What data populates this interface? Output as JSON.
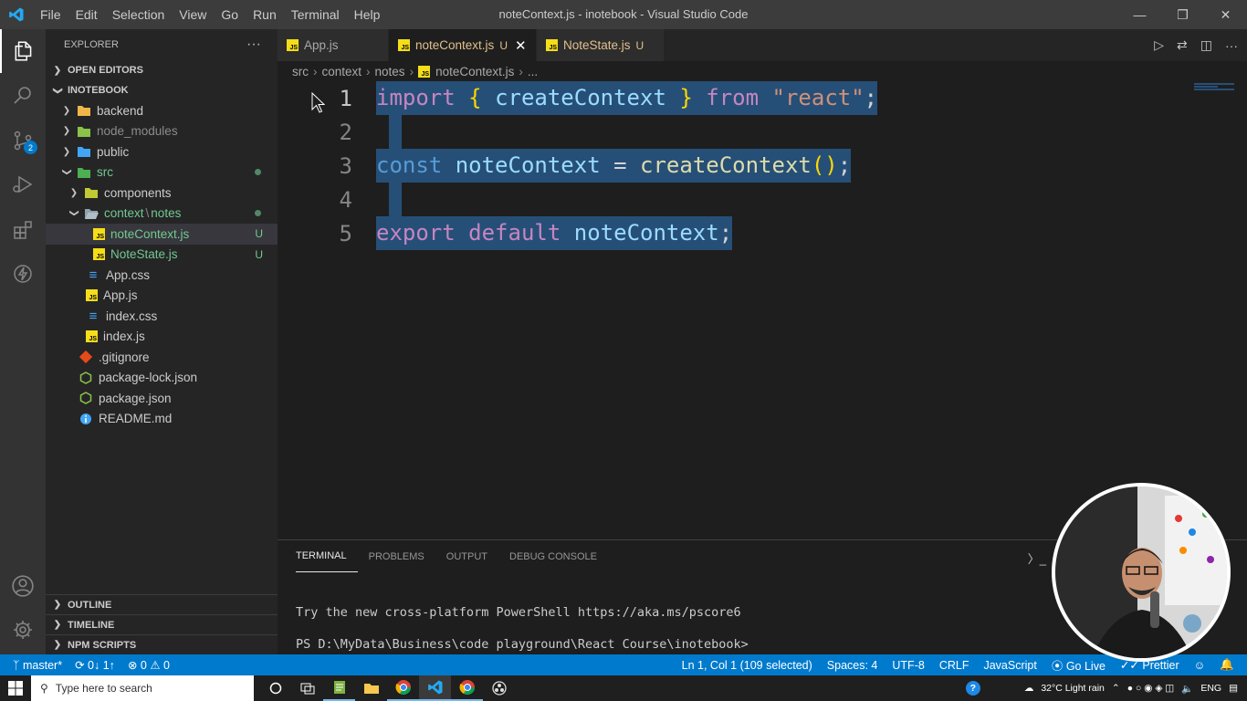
{
  "window": {
    "title": "noteContext.js - inotebook - Visual Studio Code",
    "menu": [
      "File",
      "Edit",
      "Selection",
      "View",
      "Go",
      "Run",
      "Terminal",
      "Help"
    ]
  },
  "activity": {
    "scm_badge": "2"
  },
  "sidebar": {
    "header": "EXPLORER",
    "more": "···",
    "open_editors": "OPEN EDITORS",
    "project": "INOTEBOOK",
    "tree": {
      "backend": "backend",
      "node_modules": "node_modules",
      "public": "public",
      "src": "src",
      "components": "components",
      "context": "context",
      "context_sep": "\\",
      "notes": "notes",
      "noteContext": "noteContext.js",
      "noteState": "NoteState.js",
      "app_css": "App.css",
      "app_js": "App.js",
      "index_css": "index.css",
      "index_js": "index.js",
      "gitignore": ".gitignore",
      "package_lock": "package-lock.json",
      "package": "package.json",
      "readme": "README.md"
    },
    "untracked": "U",
    "outline": "OUTLINE",
    "timeline": "TIMELINE",
    "npm": "NPM SCRIPTS"
  },
  "tabs": [
    {
      "label": "App.js"
    },
    {
      "label": "noteContext.js",
      "status": "U"
    },
    {
      "label": "NoteState.js",
      "status": "U"
    }
  ],
  "breadcrumb": [
    "src",
    "context",
    "notes",
    "noteContext.js",
    "..."
  ],
  "code": {
    "line_numbers": [
      "1",
      "2",
      "3",
      "4",
      "5"
    ],
    "l1": {
      "import": "import",
      "lbrace": "{",
      "name": "createContext",
      "rbrace": "}",
      "from": "from",
      "str": "\"react\"",
      "semi": ";"
    },
    "l3": {
      "const": "const",
      "var": "noteContext",
      "eq": "=",
      "fn": "createContext",
      "parens": "()",
      "semi": ";"
    },
    "l5": {
      "export": "export",
      "default": "default",
      "var": "noteContext",
      "semi": ";"
    }
  },
  "panel": {
    "tabs": [
      "TERMINAL",
      "PROBLEMS",
      "OUTPUT",
      "DEBUG CONSOLE"
    ],
    "line1": "Try the new cross-platform PowerShell https://aka.ms/pscore6",
    "line2": "PS D:\\MyData\\Business\\code playground\\React Course\\inotebook>"
  },
  "status": {
    "branch": "master*",
    "sync": "0↓ 1↑",
    "errors": "0",
    "warnings": "0",
    "position": "Ln 1, Col 1 (109 selected)",
    "spaces": "Spaces: 4",
    "encoding": "UTF-8",
    "eol": "CRLF",
    "language": "JavaScript",
    "golive": "Go Live",
    "prettier": "Prettier"
  },
  "taskbar": {
    "search_placeholder": "Type here to search",
    "weather": "32°C  Light rain",
    "lang": "ENG"
  },
  "colors": {
    "accent": "#007acc",
    "selection": "#264f78",
    "keyword": "#569cd6",
    "control": "#c586c0",
    "function": "#dcdcaa",
    "variable": "#9cdcfe",
    "string": "#ce9178"
  }
}
